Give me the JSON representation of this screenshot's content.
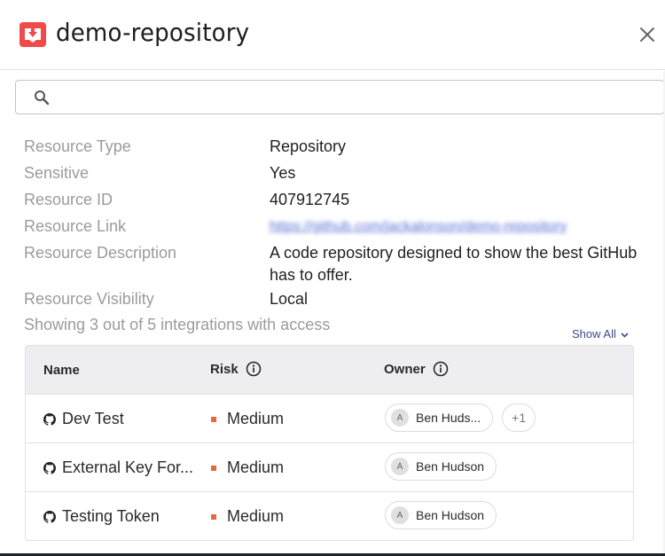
{
  "header": {
    "title": "demo-repository",
    "app_icon": "inbox-download-icon",
    "close_icon": "close-icon"
  },
  "search": {
    "placeholder": "",
    "value": "",
    "icon": "search-icon"
  },
  "details": [
    {
      "label": "Resource Type",
      "value": "Repository"
    },
    {
      "label": "Sensitive",
      "value": "Yes"
    },
    {
      "label": "Resource ID",
      "value": "407912745"
    },
    {
      "label": "Resource Link",
      "value": "https://github.com/jackalonson/demo-repository"
    },
    {
      "label": "Resource Description",
      "value": "A code repository designed to show the best GitHub has to offer."
    },
    {
      "label": "Resource Visibility",
      "value": "Local"
    }
  ],
  "integrations": {
    "summary": "Showing 3 out of 5 integrations with access",
    "show_all_label": "Show All",
    "columns": {
      "name": "Name",
      "risk": "Risk",
      "owner": "Owner"
    },
    "risk_color": "#e8683f",
    "rows": [
      {
        "name": "Dev Test",
        "icon": "github-icon",
        "risk": "Medium",
        "owner": "Ben Huds...",
        "owner_initial": "A",
        "extra_owners": "+1"
      },
      {
        "name": "External Key For...",
        "icon": "github-icon",
        "risk": "Medium",
        "owner": "Ben Hudson",
        "owner_initial": "A",
        "extra_owners": null
      },
      {
        "name": "Testing Token",
        "icon": "github-icon",
        "risk": "Medium",
        "owner": "Ben Hudson",
        "owner_initial": "A",
        "extra_owners": null
      }
    ]
  },
  "colors": {
    "brand": "#f04a4a",
    "link": "#5a6fd6",
    "show_all": "#3b4a8c",
    "table_header_bg": "#eeeef1"
  }
}
